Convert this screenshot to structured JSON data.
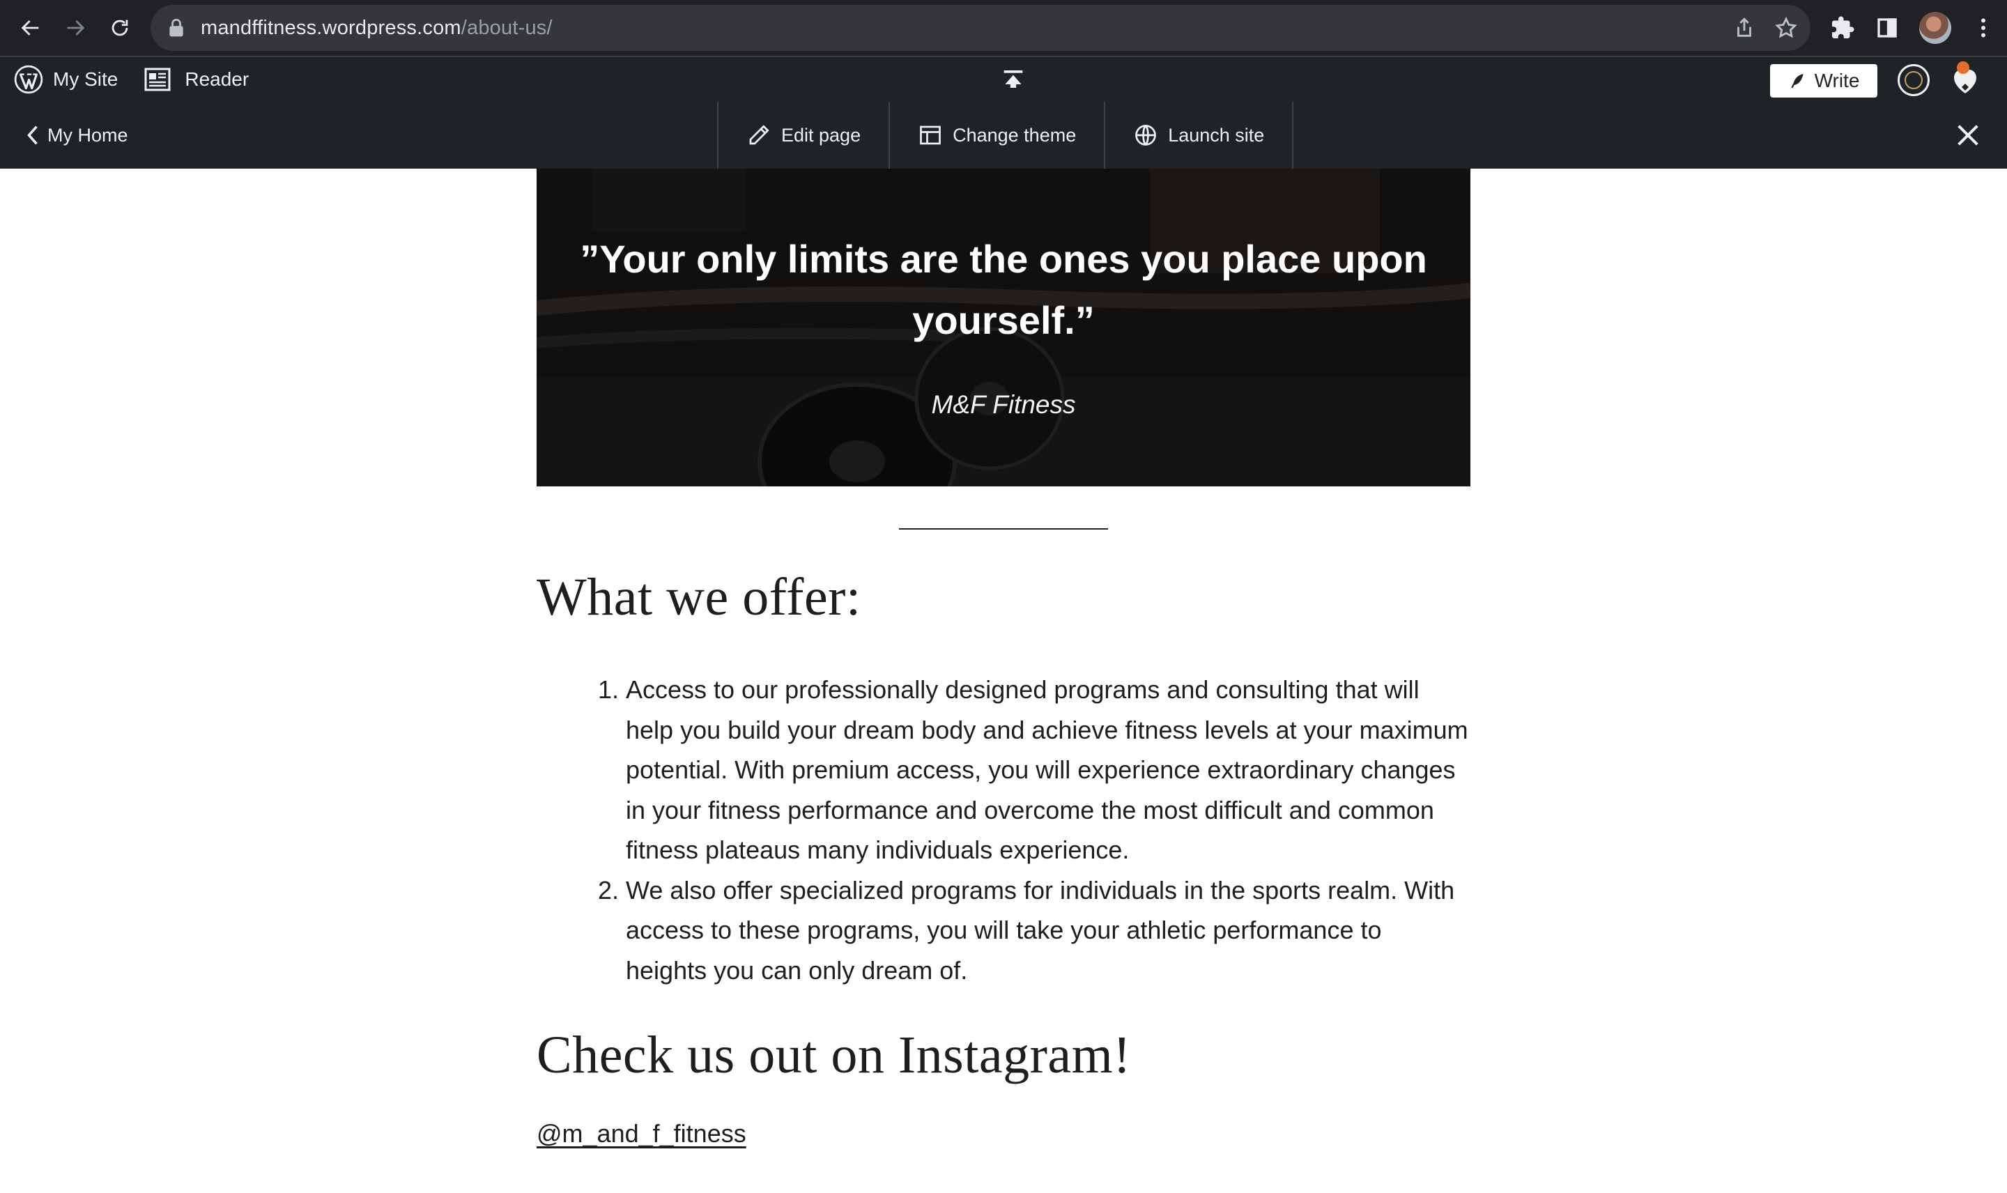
{
  "browser": {
    "url_domain": "mandffitness.wordpress.com",
    "url_path": "/about-us/"
  },
  "admin_bar": {
    "my_site": "My Site",
    "reader": "Reader",
    "write": "Write"
  },
  "editor_bar": {
    "my_home": "My Home",
    "edit_page": "Edit page",
    "change_theme": "Change theme",
    "launch_site": "Launch site"
  },
  "content": {
    "quote": "”Your only limits are the ones you place upon yourself.”",
    "quote_cite": "M&F Fitness",
    "offer_heading": "What we offer:",
    "offer_items": [
      {
        "num": "1.",
        "text": "Access to our professionally designed programs and consulting that will help you build your dream body and achieve fitness levels at your maximum potential. With premium access, you will experience extraordinary changes in your fitness performance and overcome the most difficult and common fitness plateaus many individuals experience."
      },
      {
        "num": "2.",
        "text": "We also offer specialized programs for individuals in the sports realm. With access to these programs, you will take your athletic performance to heights you can only dream of."
      }
    ],
    "instagram_heading": "Check us out on Instagram!",
    "instagram_handle": "@m_and_f_fitness"
  },
  "colors": {
    "chrome_bg": "#202124",
    "admin_bg": "#1d2327",
    "notification_dot": "#e26f2a",
    "text": "#1e1e1e"
  },
  "icons": [
    "back-arrow-icon",
    "forward-arrow-icon",
    "reload-icon",
    "lock-icon",
    "share-icon",
    "star-icon",
    "puzzle-icon",
    "side-panel-icon",
    "kebab-menu-icon",
    "wordpress-logo-icon",
    "reader-icon",
    "collapse-icon",
    "pen-icon",
    "pencil-icon",
    "layout-icon",
    "globe-icon",
    "close-icon",
    "bell-heart-icon"
  ]
}
